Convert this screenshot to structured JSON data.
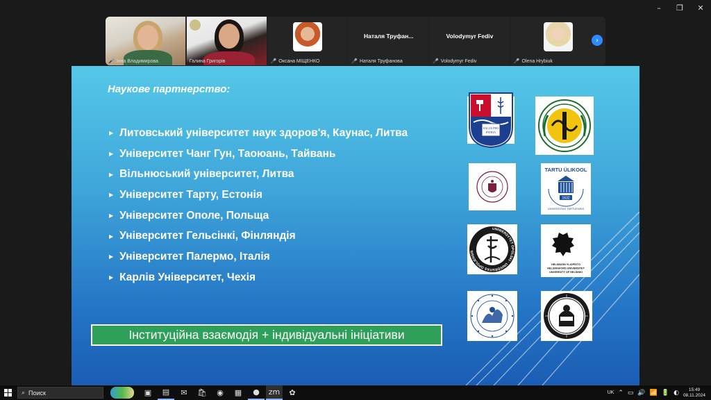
{
  "window_controls": {
    "minimize": "–",
    "restore": "❐",
    "close": "✕"
  },
  "participants": [
    {
      "name": "Інна Владимирова",
      "type": "video"
    },
    {
      "name": "Галина Григорів",
      "type": "video",
      "active": true
    },
    {
      "name": "Оксана МІЩЕНКО",
      "type": "avatar"
    },
    {
      "name": "Наталя Труфанова",
      "display": "Наталя Труфан...",
      "type": "name"
    },
    {
      "name": "Volodymyr Fediv",
      "display": "Volodymyr Fediv",
      "type": "name"
    },
    {
      "name": "Olena Hrybiuk",
      "type": "avatar"
    }
  ],
  "next_icon": "›",
  "mic_muted_icon": "🎤",
  "slide": {
    "title": "Наукове партнерство:",
    "bullet": "▶",
    "partners": [
      "Литовський університет наук здоров'я, Каунас, Литва",
      "Університет Чанг Гун, Таоюань, Тайвань",
      "Вільнюський університет, Литва",
      "Університет Тарту, Естонія",
      "Університет Ополе, Польща",
      "Університет Гельсінкі, Фінляндія",
      "Університет Палермо, Італія",
      "Карлів Університет, Чехія"
    ],
    "footer": "Інституційна взаємодія + індивідуальні ініціативи",
    "logos": {
      "kaunas": "SALUS PRO PATRIA",
      "tartu_top": "TARTU ÜLIKOOL",
      "tartu_ring": "UNIVERSITAS TARTUENSIS",
      "tartu_year": "1632",
      "opole_ring": "UNIWERSYTET OPOLSKI · UNIVERSITAS OPOLIENSIS",
      "helsinki": [
        "HELSINGIN YLIOPISTO",
        "HELSINGFORS UNIVERSITET",
        "UNIVERSITY OF HELSINKI"
      ]
    }
  },
  "taskbar": {
    "search_placeholder": "Поиск",
    "search_icon": "⌕",
    "apps": [
      "▣",
      "▤",
      "✉",
      "🛍",
      "◉",
      "▦",
      "●",
      "zm",
      "✿"
    ],
    "lang": "UK",
    "tray_icons": [
      "⌃",
      "▭",
      "🔊",
      "📶",
      "🔋",
      "◐"
    ],
    "time": "15:49",
    "date": "08.11.2024"
  }
}
